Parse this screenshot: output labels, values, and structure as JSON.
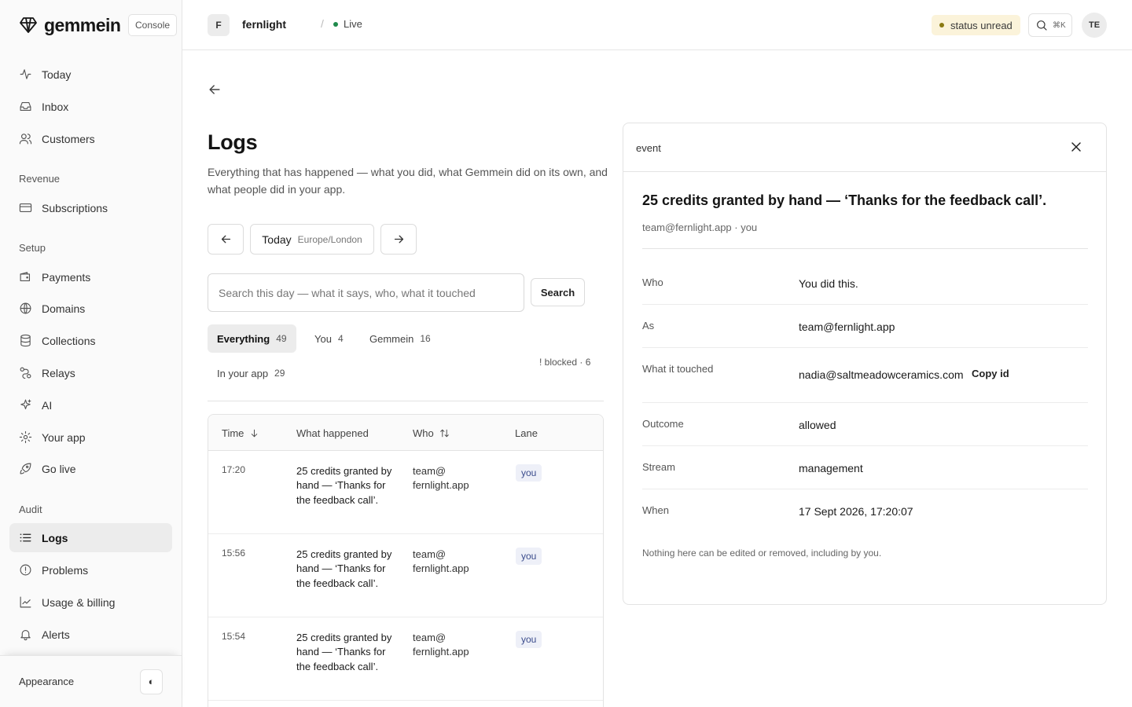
{
  "brand": {
    "name": "gemmein",
    "console_label": "Console"
  },
  "sidebar": {
    "top_items": [
      {
        "label": "Today",
        "icon": "activity-icon"
      },
      {
        "label": "Inbox",
        "icon": "inbox-icon"
      },
      {
        "label": "Customers",
        "icon": "users-icon"
      }
    ],
    "sections": [
      {
        "title": "Revenue",
        "items": [
          {
            "label": "Subscriptions",
            "icon": "credit-card-icon"
          }
        ]
      },
      {
        "title": "Setup",
        "items": [
          {
            "label": "Payments",
            "icon": "wallet-icon"
          },
          {
            "label": "Domains",
            "icon": "globe-icon"
          },
          {
            "label": "Collections",
            "icon": "database-icon"
          },
          {
            "label": "Relays",
            "icon": "relay-icon"
          },
          {
            "label": "AI",
            "icon": "sparkles-icon"
          },
          {
            "label": "Your app",
            "icon": "gear-icon"
          },
          {
            "label": "Go live",
            "icon": "rocket-icon"
          }
        ]
      },
      {
        "title": "Audit",
        "items": [
          {
            "label": "Logs",
            "icon": "list-icon",
            "active": true
          },
          {
            "label": "Problems",
            "icon": "alert-circle-icon"
          },
          {
            "label": "Usage & billing",
            "icon": "chart-icon"
          },
          {
            "label": "Alerts",
            "icon": "bell-icon"
          }
        ]
      }
    ],
    "appearance_label": "Appearance",
    "theme_toggle_glyph": "◐"
  },
  "topbar": {
    "project_initial": "F",
    "project_name": "fernlight",
    "separator": "/",
    "env_label": "Live",
    "status_label": "status unread",
    "search_kbd": "⌘K",
    "user_initials": "TE"
  },
  "page": {
    "title": "Logs",
    "description": "Everything that has happened — what you did, what Gemmein did on its own, and what people did in your app.",
    "day_label": "Today",
    "timezone": "Europe/London",
    "search_placeholder": "Search this day — what it says, who, what it touched",
    "search_button": "Search",
    "filters": [
      {
        "label": "Everything",
        "count": "49",
        "active": true
      },
      {
        "label": "You",
        "count": "4"
      },
      {
        "label": "Gemmein",
        "count": "16"
      },
      {
        "label": "In your app",
        "count": "29"
      }
    ],
    "blocked_label": "! blocked · 6"
  },
  "table": {
    "columns": {
      "time": "Time",
      "what": "What happened",
      "who": "Who",
      "lane": "Lane"
    },
    "rows": [
      {
        "time": "17:20",
        "what": "25 credits granted by hand — ‘Thanks for the feedback call’.",
        "who": "team@ fernlight.app",
        "lane": "you"
      },
      {
        "time": "15:56",
        "what": "25 credits granted by hand — ‘Thanks for the feedback call’.",
        "who": "team@ fernlight.app",
        "lane": "you"
      },
      {
        "time": "15:54",
        "what": "25 credits granted by hand — ‘Thanks for the feedback call’.",
        "who": "team@ fernlight.app",
        "lane": "you"
      }
    ]
  },
  "detail": {
    "kind": "event",
    "title": "25 credits granted by hand — ‘Thanks for the feedback call’.",
    "subtitle": "team@fernlight.app · you",
    "fields": {
      "who": {
        "key": "Who",
        "value": "You did this."
      },
      "as": {
        "key": "As",
        "value": "team@fernlight.app"
      },
      "touched": {
        "key": "What it touched",
        "value": "nadia@saltmeadowceramics.com",
        "action": "Copy id"
      },
      "outcome": {
        "key": "Outcome",
        "value": "allowed"
      },
      "stream": {
        "key": "Stream",
        "value": "management"
      },
      "when": {
        "key": "When",
        "value": "17 Sept 2026, 17:20:07"
      }
    },
    "note": "Nothing here can be edited or removed, including by you."
  }
}
